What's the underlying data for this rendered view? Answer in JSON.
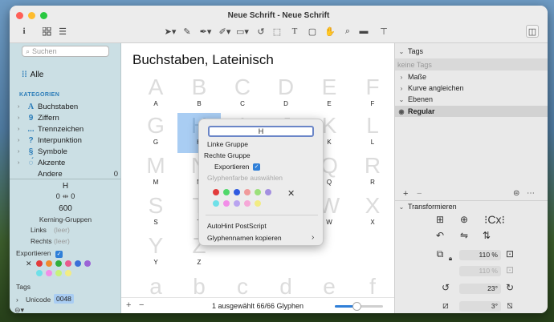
{
  "window": {
    "title": "Neue Schrift - Neue Schrift"
  },
  "colors": {
    "accent": "#2f7fd8",
    "selection": "#a9cdf3",
    "sidebar": "#cbdfe4"
  },
  "toolbar": {
    "icons": [
      "info-icon",
      "grid-view-icon",
      "list-view-icon",
      "select-tool-icon",
      "draw-tool-icon",
      "pen-tool-icon",
      "brush-tool-icon",
      "rectangle-tool-icon",
      "rotate-tool-icon",
      "measure-tool-icon",
      "text-tool-icon",
      "annotation-tool-icon",
      "hand-tool-icon",
      "zoom-tool-icon",
      "preview-icon",
      "sidebar-toggle-icon"
    ]
  },
  "sidebar": {
    "search_placeholder": "Suchen",
    "all_label": "Alle",
    "categories_header": "KATEGORIEN",
    "categories": [
      {
        "icon": "A",
        "label": "Buchstaben",
        "count": ""
      },
      {
        "icon": "9",
        "label": "Ziffern",
        "count": ""
      },
      {
        "icon": "...",
        "label": "Trennzeichen",
        "count": ""
      },
      {
        "icon": "?",
        "label": "Interpunktion",
        "count": ""
      },
      {
        "icon": "§",
        "label": "Symbole",
        "count": ""
      },
      {
        "icon": "◌́",
        "label": "Akzente",
        "count": ""
      },
      {
        "icon": "",
        "label": "Andere",
        "count": "0"
      }
    ]
  },
  "inspector": {
    "glyph_name": "H",
    "lsb": "0",
    "rsb": "0",
    "width": "600",
    "kerning_label": "Kerning-Gruppen",
    "links_label": "Links",
    "links_value": "(leer)",
    "rechts_label": "Rechts",
    "rechts_value": "(leer)",
    "export_label": "Exportieren",
    "tags_label": "Tags",
    "unicode_label": "Unicode",
    "unicode_value": "0048",
    "colors": [
      "#e23b3b",
      "#f08c2c",
      "#2fae3c",
      "#e85a8e",
      "#3a6fd8",
      "#9c64d6",
      "#6fe0e8",
      "#f28ee8",
      "#c9f27a",
      "#f2ec84"
    ]
  },
  "main": {
    "section_title": "Buchstaben, Lateinisch",
    "rows": [
      [
        "A",
        "B",
        "C",
        "D",
        "E",
        "F"
      ],
      [
        "G",
        "H",
        "I",
        "J",
        "K",
        "L"
      ],
      [
        "M",
        "N",
        "O",
        "P",
        "Q",
        "R"
      ],
      [
        "S",
        "T",
        "U",
        "V",
        "W",
        "X"
      ],
      [
        "Y",
        "Z",
        "",
        "",
        "",
        ""
      ],
      [
        "a",
        "b",
        "c",
        "d",
        "e",
        "f"
      ]
    ],
    "selected": "H",
    "status": "1 ausgewählt 66/66 Glyphen",
    "zoom_fraction": 0.45
  },
  "context_menu": {
    "glyph_field": "H",
    "items": [
      "Linke Gruppe",
      "Rechte Gruppe",
      "Exportieren"
    ],
    "color_header": "Glyphenfarbe auswählen",
    "colors": [
      "#e23b3b",
      "#4fd86a",
      "#2f5ae0",
      "#f09a9a",
      "#9be07a",
      "#a38fe0",
      "#6fe0e8",
      "#f28ee8",
      "#b9a4f0",
      "#f6a8d8",
      "#f2ec84"
    ],
    "autohint": "AutoHint PostScript",
    "copy_names": "Glyphennamen kopieren"
  },
  "right_panel": {
    "tags_header": "Tags",
    "tags_placeholder": "keine Tags",
    "masse": "Maße",
    "kurve": "Kurve angleichen",
    "ebenen": "Ebenen",
    "layer": "Regular",
    "transform_header": "Transformieren",
    "scale_x": "110 %",
    "scale_y": "110 %",
    "rotate": "23°",
    "slant": "3°"
  }
}
